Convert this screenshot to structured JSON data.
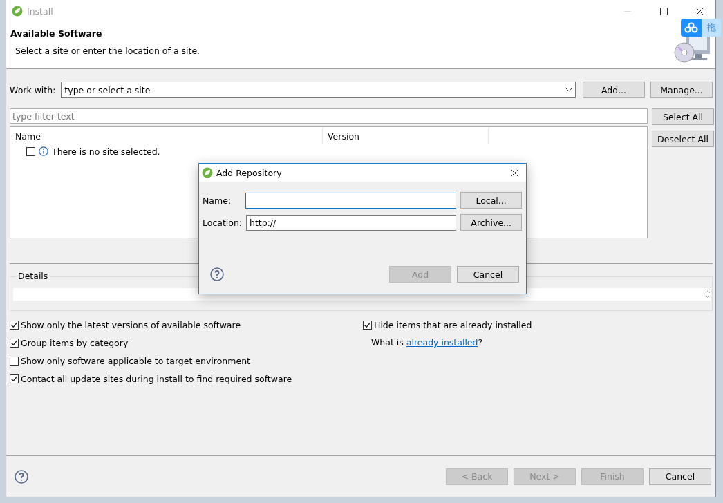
{
  "window": {
    "title": "Install"
  },
  "header": {
    "title": "Available Software",
    "subtitle": "Select a site or enter the location of a site."
  },
  "cloud_widget": {
    "label": "拖"
  },
  "work_with": {
    "label": "Work with:",
    "value": "type or select a site",
    "buttons": [
      "Add...",
      "Manage..."
    ]
  },
  "filter": {
    "placeholder": "type filter text"
  },
  "side_buttons": [
    "Select All",
    "Deselect All"
  ],
  "table": {
    "columns": [
      "Name",
      "Version"
    ],
    "rows": [
      {
        "text": "There is no site selected.",
        "checked": false
      }
    ]
  },
  "details": {
    "label": "Details"
  },
  "options_left": [
    {
      "label": "Show only the latest versions of available software",
      "checked": true
    },
    {
      "label": "Group items by category",
      "checked": true
    },
    {
      "label": "Show only software applicable to target environment",
      "checked": false
    },
    {
      "label": "Contact all update sites during install to find required software",
      "checked": true
    }
  ],
  "options_right": [
    {
      "label": "Hide items that are already installed",
      "checked": true
    }
  ],
  "installed_note": {
    "prefix": "What is ",
    "link": "already installed",
    "suffix": "?"
  },
  "footer": {
    "buttons": [
      {
        "label": "< Back",
        "disabled": true
      },
      {
        "label": "Next >",
        "disabled": true
      },
      {
        "label": "Finish",
        "disabled": true
      },
      {
        "label": "Cancel",
        "disabled": false
      }
    ]
  },
  "dialog": {
    "title": "Add Repository",
    "fields": [
      {
        "label": "Name:",
        "focused": true,
        "button": "Local..."
      },
      {
        "label": "Location:",
        "value": "http://",
        "focused": false,
        "button": "Archive..."
      }
    ],
    "buttons": [
      {
        "label": "Add",
        "disabled": true
      },
      {
        "label": "Cancel",
        "disabled": false
      }
    ]
  }
}
